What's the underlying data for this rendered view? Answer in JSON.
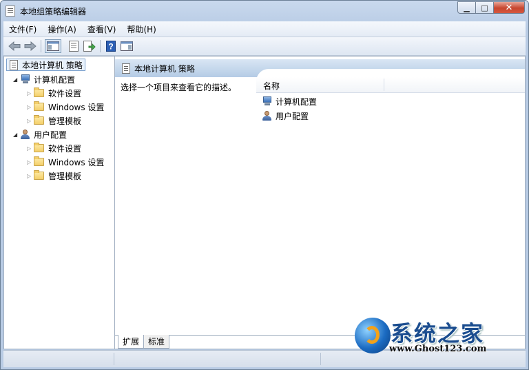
{
  "window": {
    "title": "本地组策略编辑器"
  },
  "menu": [
    "文件(F)",
    "操作(A)",
    "查看(V)",
    "帮助(H)"
  ],
  "tree": {
    "root": "本地计算机 策略",
    "computer": {
      "label": "计算机配置",
      "children": [
        "软件设置",
        "Windows 设置",
        "管理模板"
      ]
    },
    "user": {
      "label": "用户配置",
      "children": [
        "软件设置",
        "Windows 设置",
        "管理模板"
      ]
    }
  },
  "content": {
    "header_title": "本地计算机 策略",
    "description": "选择一个项目来查看它的描述。",
    "column_name": "名称",
    "items": [
      "计算机配置",
      "用户配置"
    ]
  },
  "tabs": [
    "扩展",
    "标准"
  ],
  "watermark": {
    "name": "系统之家",
    "url": "www.Ghost123.com"
  },
  "colors": {
    "title_gradient": "#c9d9ee",
    "header_band": "#b4cbe5",
    "close_button": "#c7462f"
  }
}
